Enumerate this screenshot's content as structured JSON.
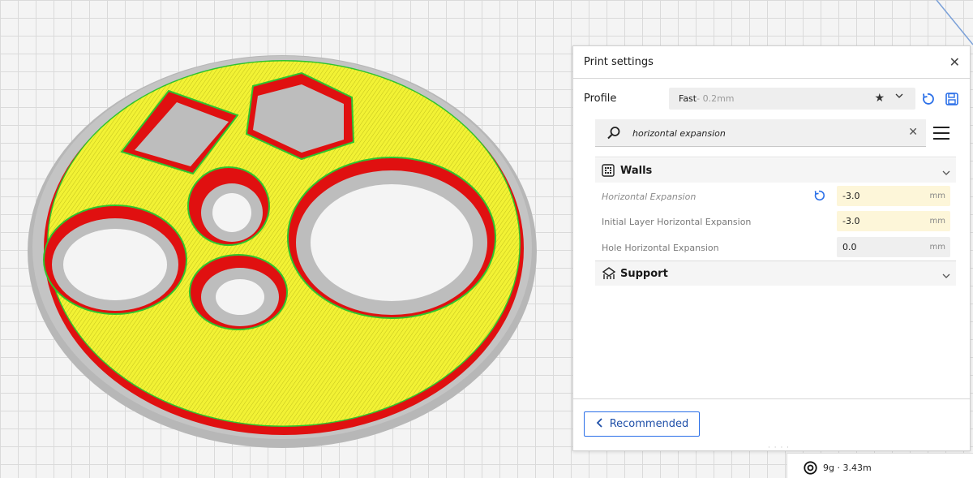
{
  "panel": {
    "title": "Print settings",
    "profile_label": "Profile",
    "profile_name": "Fast",
    "profile_layer": " - 0.2mm",
    "search_value": "horizontal expansion"
  },
  "sections": {
    "walls_title": "Walls",
    "support_title": "Support"
  },
  "settings": [
    {
      "label": "Horizontal Expansion",
      "value": "-3.0",
      "unit": "mm"
    },
    {
      "label": "Initial Layer Horizontal Expansion",
      "value": "-3.0",
      "unit": "mm"
    },
    {
      "label": "Hole Horizontal Expansion",
      "value": "0.0",
      "unit": "mm"
    }
  ],
  "footer": {
    "recommended_label": "Recommended",
    "estimate": "9g · 3.43m"
  },
  "icons": {
    "close": "close-icon",
    "star": "star-icon",
    "chevron": "chevron-down-icon",
    "reset": "reset-icon",
    "save": "save-icon",
    "search": "search-icon",
    "menu": "hamburger-menu-icon",
    "walls": "walls-icon",
    "support": "support-icon",
    "back": "chevron-left-icon",
    "spool": "spool-icon"
  },
  "colors": {
    "accent": "#2a6fe8",
    "changed_field": "#fdf6d9",
    "wall_red": "#e01010",
    "infill_yellow": "#efef2a",
    "outline_green": "#2ec42e",
    "model_gray": "#b7b7b7"
  }
}
